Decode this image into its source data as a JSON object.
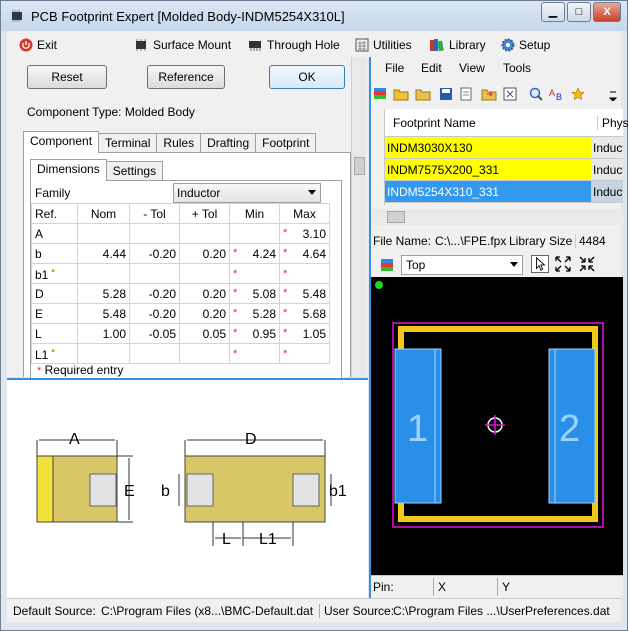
{
  "window": {
    "title": "PCB Footprint Expert [Molded Body-INDM5254X310L]",
    "min_label": "▁",
    "max_label": "□",
    "close_label": "X"
  },
  "menu": {
    "exit": "Exit",
    "surface_mount": "Surface Mount",
    "through_hole": "Through Hole",
    "utilities": "Utilities",
    "library": "Library",
    "setup": "Setup"
  },
  "buttons": {
    "reset": "Reset",
    "reference": "Reference",
    "ok": "OK"
  },
  "component_type": "Component Type: Molded Body",
  "tabs": [
    "Component",
    "Terminal",
    "Rules",
    "Drafting",
    "Footprint"
  ],
  "subtabs": [
    "Dimensions",
    "Settings"
  ],
  "family": {
    "label": "Family",
    "value": "Inductor"
  },
  "table": {
    "headers": [
      "Ref.",
      "Nom",
      "- Tol",
      "+ Tol",
      "Min",
      "Max"
    ],
    "rows": [
      {
        "ref": "A",
        "nom": "",
        "mtol": "",
        "ptol": "",
        "min": "",
        "max": "3.10",
        "min_req": false,
        "max_req": true,
        "dot": false
      },
      {
        "ref": "b",
        "nom": "4.44",
        "mtol": "-0.20",
        "ptol": "0.20",
        "min": "4.24",
        "max": "4.64",
        "min_req": true,
        "max_req": true,
        "dot": false
      },
      {
        "ref": "b1",
        "nom": "",
        "mtol": "",
        "ptol": "",
        "min": "",
        "max": "",
        "min_req": true,
        "max_req": true,
        "dot": true
      },
      {
        "ref": "D",
        "nom": "5.28",
        "mtol": "-0.20",
        "ptol": "0.20",
        "min": "5.08",
        "max": "5.48",
        "min_req": true,
        "max_req": true,
        "dot": false
      },
      {
        "ref": "E",
        "nom": "5.48",
        "mtol": "-0.20",
        "ptol": "0.20",
        "min": "5.28",
        "max": "5.68",
        "min_req": true,
        "max_req": true,
        "dot": false
      },
      {
        "ref": "L",
        "nom": "1.00",
        "mtol": "-0.05",
        "ptol": "0.05",
        "min": "0.95",
        "max": "1.05",
        "min_req": true,
        "max_req": true,
        "dot": false
      },
      {
        "ref": "L1",
        "nom": "",
        "mtol": "",
        "ptol": "",
        "min": "",
        "max": "",
        "min_req": true,
        "max_req": true,
        "dot": true
      }
    ],
    "required_note": "Required entry"
  },
  "drawing": {
    "A": "A",
    "D": "D",
    "E": "E",
    "b": "b",
    "b1": "b1",
    "L": "L",
    "L1": "L1"
  },
  "right": {
    "menu": [
      "File",
      "Edit",
      "View",
      "Tools"
    ],
    "grid_header": "Footprint Name",
    "grid_header2": "Physi",
    "rows": [
      {
        "name": "INDM3030X130",
        "col2": "Induct"
      },
      {
        "name": "INDM7575X200_331",
        "col2": "Induct"
      },
      {
        "name": "INDM5254X310_331",
        "col2": "Induct"
      }
    ],
    "file_name_label": "File Name:",
    "file_name_value": "C:\\...\\FPE.fpx",
    "lib_size_label": "Library Size",
    "lib_size_value": "4484",
    "layer": "Top",
    "pad1": "1",
    "pad2": "2",
    "pin_label": "Pin:",
    "x_label": "X",
    "y_label": "Y"
  },
  "status": {
    "default_label": "Default Source:",
    "default_value": "C:\\Program Files (x8...\\BMC-Default.dat",
    "user_label": "User Source:",
    "user_value": "C:\\Program Files ...\\UserPreferences.dat"
  }
}
